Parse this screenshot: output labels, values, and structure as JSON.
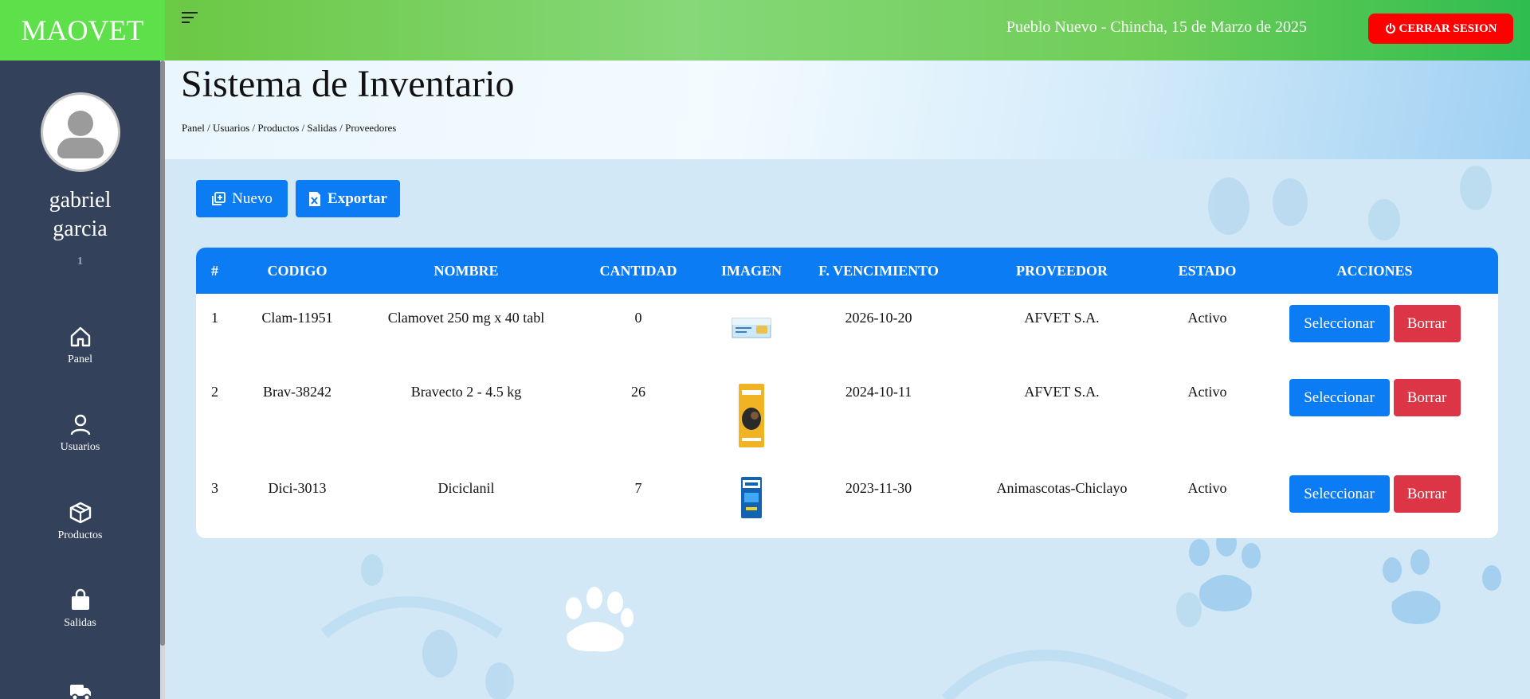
{
  "brand": "MAOVET",
  "header": {
    "location_date": "Pueblo Nuevo - Chincha, 15 de Marzo de 2025",
    "logout_label": "CERRAR SESION"
  },
  "user": {
    "first_name": "gabriel",
    "last_name": "garcia",
    "id": "1"
  },
  "sidebar": {
    "items": [
      {
        "label": "Panel",
        "icon": "home-icon"
      },
      {
        "label": "Usuarios",
        "icon": "user-icon"
      },
      {
        "label": "Productos",
        "icon": "box-icon"
      },
      {
        "label": "Salidas",
        "icon": "bag-icon"
      },
      {
        "label": "",
        "icon": "truck-icon"
      }
    ]
  },
  "page": {
    "title": "Sistema de Inventario",
    "breadcrumb": "Panel / Usuarios / Productos / Salidas / Proveedores"
  },
  "toolbar": {
    "new_label": "Nuevo",
    "export_label": "Exportar"
  },
  "table": {
    "headers": [
      "#",
      "CODIGO",
      "NOMBRE",
      "CANTIDAD",
      "IMAGEN",
      "F. VENCIMIENTO",
      "PROVEEDOR",
      "ESTADO",
      "ACCIONES"
    ],
    "rows": [
      {
        "num": "1",
        "code": "Clam-11951",
        "name": "Clamovet 250 mg x 40 tabl",
        "qty": "0",
        "expiry": "2026-10-20",
        "supplier": "AFVET S.A.",
        "status": "Activo"
      },
      {
        "num": "2",
        "code": "Brav-38242",
        "name": "Bravecto 2 - 4.5 kg",
        "qty": "26",
        "expiry": "2024-10-11",
        "supplier": "AFVET S.A.",
        "status": "Activo"
      },
      {
        "num": "3",
        "code": "Dici-3013",
        "name": "Diciclanil",
        "qty": "7",
        "expiry": "2023-11-30",
        "supplier": "Animascotas-Chiclayo",
        "status": "Activo"
      }
    ],
    "select_label": "Seleccionar",
    "delete_label": "Borrar"
  },
  "colors": {
    "primary": "#0c7cf4",
    "danger": "#dc3545",
    "logout": "#ff0000",
    "sidebar": "#34415a",
    "topbar": "#5ee04a"
  }
}
